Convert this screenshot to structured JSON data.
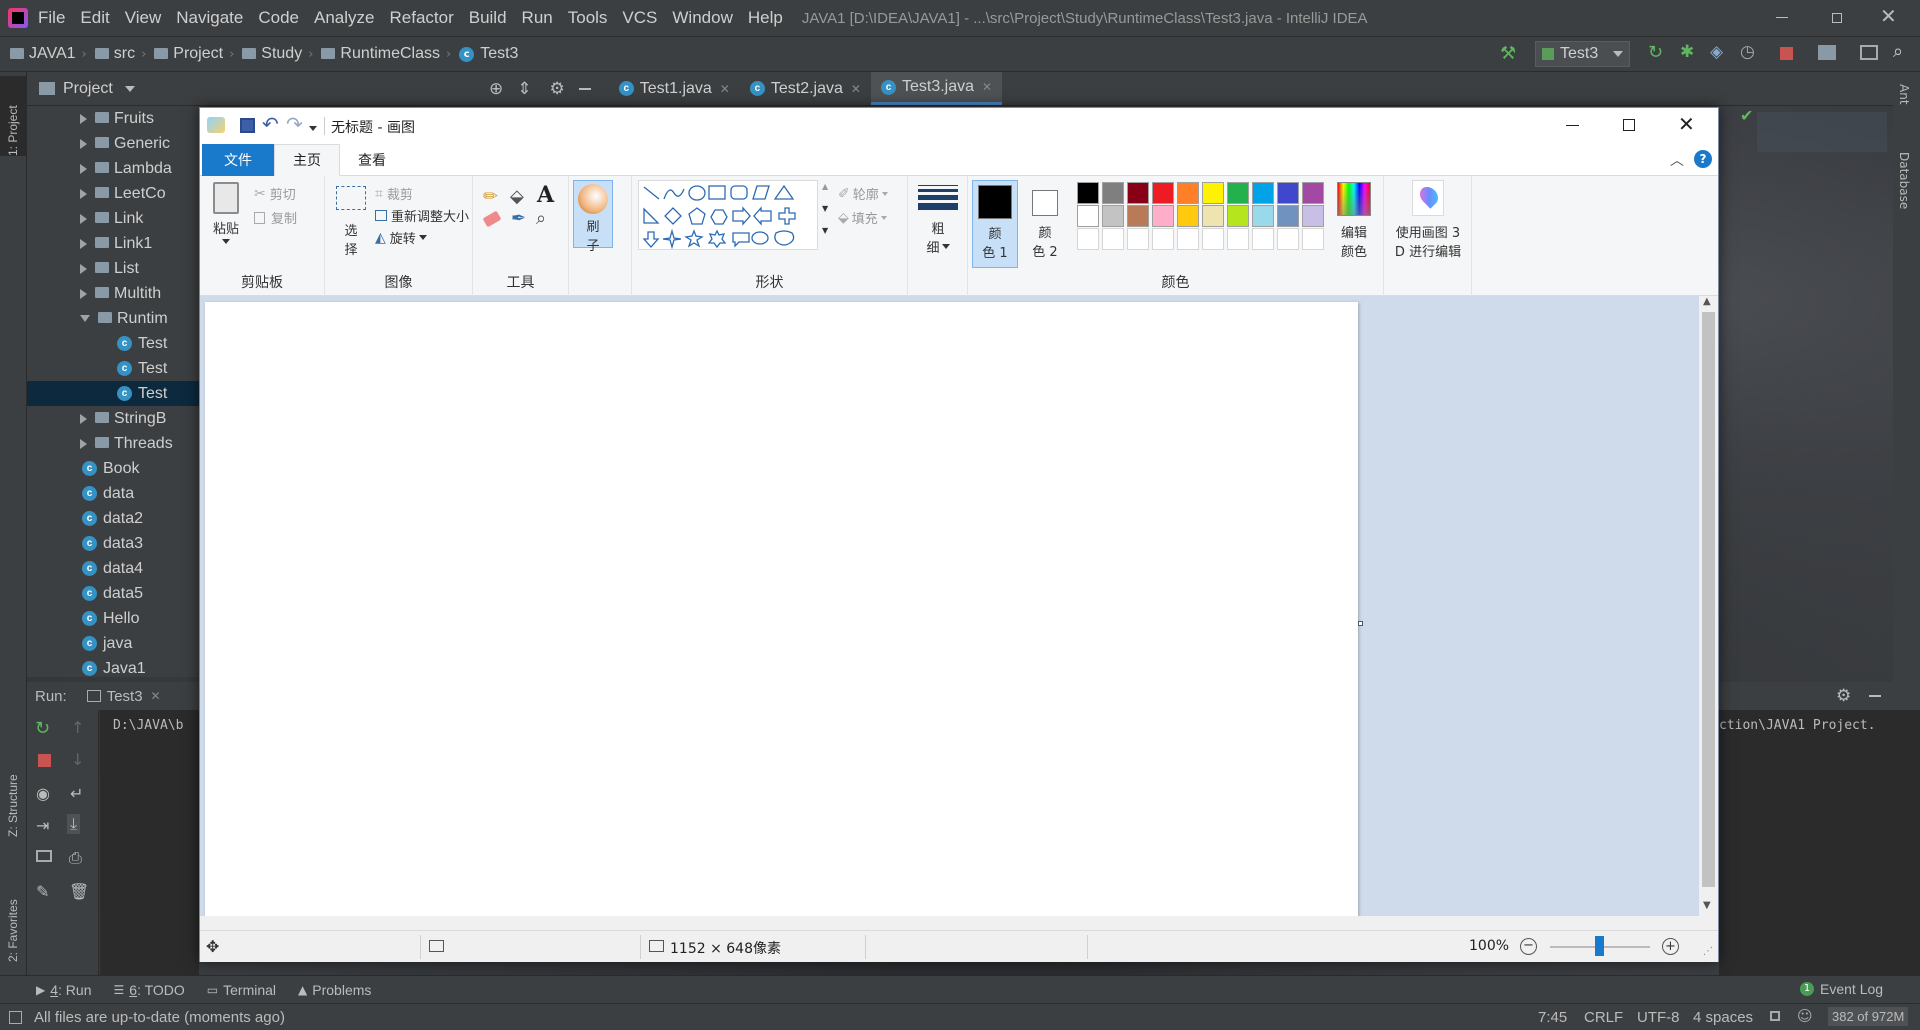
{
  "ide": {
    "window_title": "JAVA1 [D:\\IDEA\\JAVA1] - ...\\src\\Project\\Study\\RuntimeClass\\Test3.java - IntelliJ IDEA",
    "menu": [
      "File",
      "Edit",
      "View",
      "Navigate",
      "Code",
      "Analyze",
      "Refactor",
      "Build",
      "Run",
      "Tools",
      "VCS",
      "Window",
      "Help"
    ],
    "breadcrumb": [
      "JAVA1",
      "src",
      "Project",
      "Study",
      "RuntimeClass",
      "Test3"
    ],
    "run_config": "Test3",
    "left_strip_labels": {
      "project": "1: Project",
      "structure": "Z: Structure",
      "favorites": "2: Favorites"
    },
    "right_strip_labels": {
      "ant": "Ant",
      "database": "Database"
    },
    "project_panel_title": "Project",
    "tree": [
      {
        "label": "Fruits",
        "type": "folder",
        "expanded": false,
        "indent": 1
      },
      {
        "label": "Generic",
        "type": "folder",
        "expanded": false,
        "indent": 1
      },
      {
        "label": "Lambda",
        "type": "folder",
        "expanded": false,
        "indent": 1
      },
      {
        "label": "LeetCo",
        "type": "folder",
        "expanded": false,
        "indent": 1
      },
      {
        "label": "Link",
        "type": "folder",
        "expanded": false,
        "indent": 1
      },
      {
        "label": "Link1",
        "type": "folder",
        "expanded": false,
        "indent": 1
      },
      {
        "label": "List",
        "type": "folder",
        "expanded": false,
        "indent": 1
      },
      {
        "label": "Multith",
        "type": "folder",
        "expanded": false,
        "indent": 1
      },
      {
        "label": "Runtim",
        "type": "folder",
        "expanded": true,
        "indent": 1
      },
      {
        "label": "Test",
        "type": "class",
        "indent": 2
      },
      {
        "label": "Test",
        "type": "class",
        "indent": 2
      },
      {
        "label": "Test",
        "type": "class",
        "indent": 2,
        "selected": true
      },
      {
        "label": "StringB",
        "type": "folder",
        "expanded": false,
        "indent": 1
      },
      {
        "label": "Threads",
        "type": "folder",
        "expanded": false,
        "indent": 1
      },
      {
        "label": "Book",
        "type": "class",
        "indent": 0
      },
      {
        "label": "data",
        "type": "class",
        "indent": 0
      },
      {
        "label": "data2",
        "type": "class",
        "indent": 0
      },
      {
        "label": "data3",
        "type": "class",
        "indent": 0
      },
      {
        "label": "data4",
        "type": "class",
        "indent": 0
      },
      {
        "label": "data5",
        "type": "class",
        "indent": 0
      },
      {
        "label": "Hello",
        "type": "class",
        "indent": 0
      },
      {
        "label": "java",
        "type": "class",
        "indent": 0
      },
      {
        "label": "Java1",
        "type": "class",
        "indent": 0
      }
    ],
    "editor_tabs": [
      {
        "label": "Test1.java",
        "active": false
      },
      {
        "label": "Test2.java",
        "active": false
      },
      {
        "label": "Test3.java",
        "active": true
      }
    ],
    "run_label": "Run:",
    "run_tab": "Test3",
    "console_left_text": "D:\\JAVA\\b",
    "console_right_text": "ction\\JAVA1 Project.",
    "bottom_tools": [
      {
        "num": "4",
        "label": ": Run"
      },
      {
        "num": "6",
        "label": ": TODO"
      },
      {
        "num": "",
        "label": "Terminal"
      },
      {
        "num": "",
        "label": "Problems"
      }
    ],
    "event_log": "Event Log",
    "event_log_count": "1",
    "status": {
      "message": "All files are up-to-date (moments ago)",
      "position": "7:45",
      "line_sep": "CRLF",
      "encoding": "UTF-8",
      "indent": "4 spaces",
      "memory": "382 of 972M"
    }
  },
  "paint": {
    "title": "无标题 - 画图",
    "tabs": [
      "文件",
      "主页",
      "查看"
    ],
    "clipboard": {
      "paste": "粘贴",
      "cut": "剪切",
      "copy": "复制",
      "group": "剪贴板"
    },
    "image": {
      "select_top": "选",
      "select_bottom": "择",
      "crop": "裁剪",
      "resize": "重新调整大小",
      "rotate": "旋转",
      "group": "图像"
    },
    "tools": {
      "group": "工具"
    },
    "brush": {
      "top": "刷",
      "bottom": "子"
    },
    "shapes": {
      "outline": "轮廓",
      "fill": "填充",
      "group": "形状"
    },
    "size": {
      "top": "粗",
      "bottom": "细"
    },
    "color1": {
      "top": "颜",
      "bottom": "色 1"
    },
    "color2": {
      "top": "颜",
      "bottom": "色 2"
    },
    "colors_group": "颜色",
    "edit_colors": {
      "top": "编辑",
      "bottom": "颜色"
    },
    "paint3d": {
      "top": "使用画图 3",
      "bottom": "D 进行编辑"
    },
    "palette_row1": [
      "#000000",
      "#7f7f7f",
      "#880015",
      "#ed1c24",
      "#ff7f27",
      "#fff200",
      "#22b14c",
      "#00a2e8",
      "#3f48cc",
      "#a349a4"
    ],
    "palette_row2": [
      "#ffffff",
      "#c3c3c3",
      "#b97a57",
      "#ffaec9",
      "#ffc90e",
      "#efe4b0",
      "#b5e61d",
      "#99d9ea",
      "#7092be",
      "#c8bfe7"
    ],
    "status": {
      "dimensions": "1152 × 648像素",
      "zoom": "100%"
    }
  }
}
